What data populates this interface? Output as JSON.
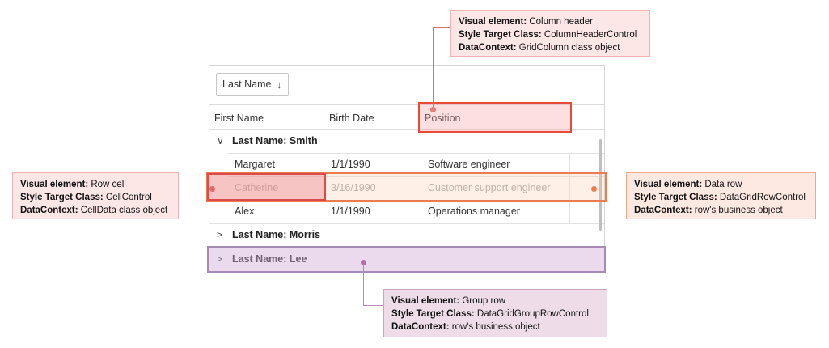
{
  "grid": {
    "group_chip": {
      "label": "Last Name",
      "arrow": "↓"
    },
    "columns": [
      "First Name",
      "Birth Date",
      "Position"
    ],
    "groups": {
      "smith": {
        "chevron": "∨",
        "label": "Last Name: Smith"
      },
      "morris": {
        "chevron": ">",
        "label": "Last Name: Morris"
      },
      "lee": {
        "chevron": ">",
        "label": "Last Name: Lee"
      }
    },
    "rows": [
      {
        "first": "Margaret",
        "birth": "1/1/1990",
        "position": "Software engineer"
      },
      {
        "first": "Catherine",
        "birth": "3/16/1990",
        "position": "Customer support engineer"
      },
      {
        "first": "Alex",
        "birth": "1/1/1990",
        "position": "Operations manager"
      }
    ]
  },
  "callouts": {
    "header": {
      "l1k": "Visual element:",
      "l1v": " Column header",
      "l2k": "Style Target Class:",
      "l2v": " ColumnHeaderControl",
      "l3k": "DataContext:",
      "l3v": " GridColumn class object"
    },
    "cell": {
      "l1k": "Visual element:",
      "l1v": " Row cell",
      "l2k": "Style Target Class:",
      "l2v": " CellControl",
      "l3k": "DataContext:",
      "l3v": " CellData class object"
    },
    "row": {
      "l1k": "Visual element:",
      "l1v": " Data row",
      "l2k": "Style Target Class:",
      "l2v": " DataGridRowControl",
      "l3k": "DataContext:",
      "l3v": " row's business object"
    },
    "group": {
      "l1k": "Visual element:",
      "l1v": " Group row",
      "l2k": "Style Target Class:",
      "l2v": " DataGridGroupRowControl",
      "l3k": "DataContext:",
      "l3v": " row's business object"
    }
  },
  "colors": {
    "header_highlight": "#e84a3a",
    "row_highlight": "#ee7a50",
    "cell_highlight": "#dc4a4a",
    "group_highlight": "#a58ab5"
  }
}
